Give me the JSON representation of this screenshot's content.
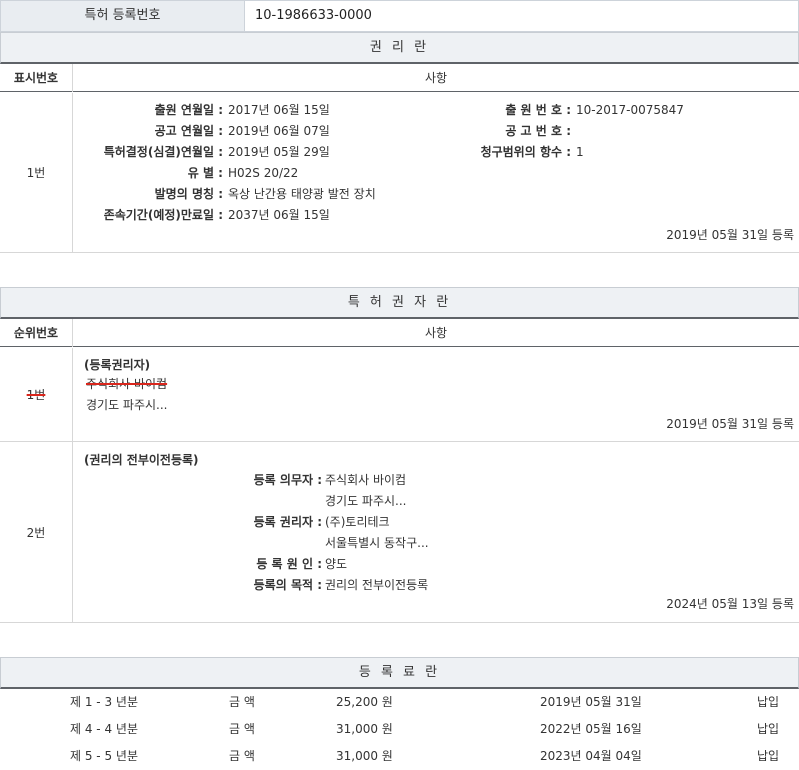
{
  "top": {
    "label": "특허 등록번호",
    "value": "10-1986633-0000"
  },
  "rights": {
    "title": "권 리 란",
    "header": {
      "col1": "표시번호",
      "col2": "사항"
    },
    "row": {
      "num": "1번",
      "left": [
        {
          "label": "출원 연월일 :",
          "value": "2017년 06월 15일"
        },
        {
          "label": "공고 연월일 :",
          "value": "2019년 06월 07일"
        },
        {
          "label": "특허결정(심결)연월일 :",
          "value": "2019년 05월 29일"
        },
        {
          "label": "유 별 :",
          "value": "H02S 20/22"
        },
        {
          "label": "발명의 명칭 :",
          "value": "옥상 난간용 태양광 발전 장치"
        },
        {
          "label": "존속기간(예정)만료일 :",
          "value": "2037년 06월 15일"
        }
      ],
      "right": [
        {
          "label": "출 원 번 호 :",
          "value": "10-2017-0075847"
        },
        {
          "label": "공 고 번 호 :",
          "value": ""
        },
        {
          "label": "청구범위의 항수 :",
          "value": "1"
        }
      ],
      "stamp": "2019년 05월 31일 등록"
    }
  },
  "holders": {
    "title": "특 허 권 자 란",
    "header": {
      "col1": "순위번호",
      "col2": "사항"
    },
    "row1": {
      "num": "1번",
      "type": "(등록권리자)",
      "name": "주식회사 바이컴",
      "address": "경기도 파주시...",
      "stamp": "2019년 05월 31일 등록"
    },
    "row2": {
      "num": "2번",
      "type": "(권리의 전부이전등록)",
      "fields": [
        {
          "label": "등록 의무자 :",
          "value": "주식회사 바이컴"
        },
        {
          "label": "",
          "value": "경기도 파주시..."
        },
        {
          "label": "등록 권리자 :",
          "value": "(주)토리테크"
        },
        {
          "label": "",
          "value": "서울특별시 동작구..."
        },
        {
          "label": "등 록 원 인 :",
          "value": "양도"
        },
        {
          "label": "등록의 목적 :",
          "value": "권리의 전부이전등록"
        }
      ],
      "stamp": "2024년 05월 13일 등록"
    }
  },
  "fees": {
    "title": "등 록 료 란",
    "rows": [
      {
        "period": "제 1 - 3 년분",
        "label": "금 액",
        "amount": "25,200 원",
        "date": "2019년 05월 31일",
        "status": "납입"
      },
      {
        "period": "제 4 - 4 년분",
        "label": "금 액",
        "amount": "31,000 원",
        "date": "2022년 05월 16일",
        "status": "납입"
      },
      {
        "period": "제 5 - 5 년분",
        "label": "금 액",
        "amount": "31,000 원",
        "date": "2023년 04월 04일",
        "status": "납입"
      }
    ]
  },
  "colors": {
    "strike": "#d9261c",
    "section_bg": "#eef1f4",
    "rule": "#5f6368"
  }
}
